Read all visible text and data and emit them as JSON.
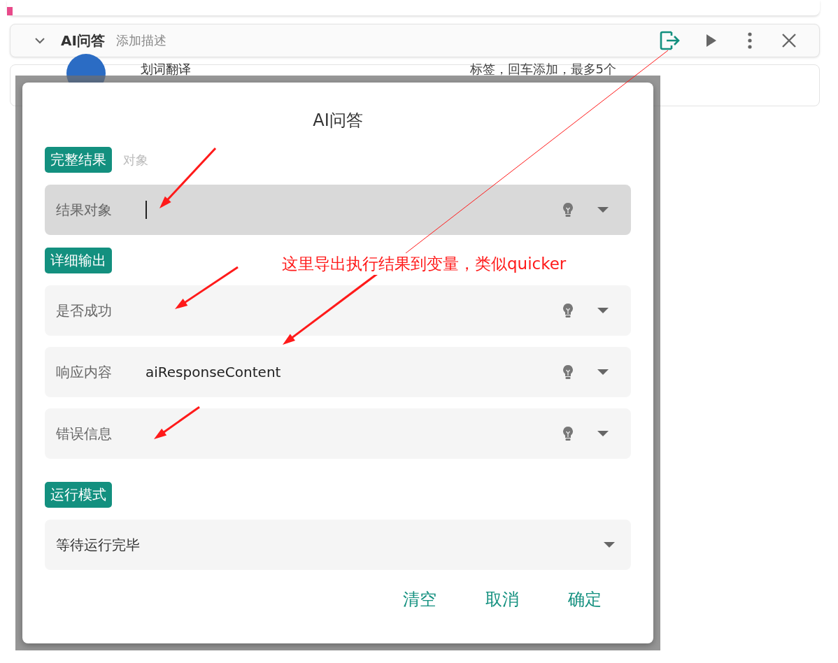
{
  "header": {
    "title": "AI问答",
    "description_placeholder": "添加描述",
    "expanded": true
  },
  "background_row": {
    "title": "划词翻译",
    "tags_placeholder": "标签，回车添加，最多5个"
  },
  "dialog": {
    "title": "AI问答",
    "sections": [
      {
        "tag": "完整结果",
        "hint": "对象",
        "fields": [
          {
            "kind": "variable",
            "label": "结果对象",
            "focused": true
          }
        ]
      },
      {
        "tag": "详细输出",
        "fields": [
          {
            "kind": "variable",
            "label": "是否成功",
            "focused": false
          },
          {
            "kind": "variable",
            "label": "响应内容",
            "value": "aiResponseContent",
            "focused": false
          },
          {
            "kind": "variable",
            "label": "错误信息",
            "focused": false
          }
        ]
      },
      {
        "tag": "运行模式",
        "fields": [
          {
            "kind": "select",
            "label": "等待运行完毕",
            "focused": false
          }
        ]
      }
    ],
    "buttons": [
      "清空",
      "取消",
      "确定"
    ]
  },
  "annotation": {
    "text": "这里导出执行结果到变量，类似quicker"
  }
}
